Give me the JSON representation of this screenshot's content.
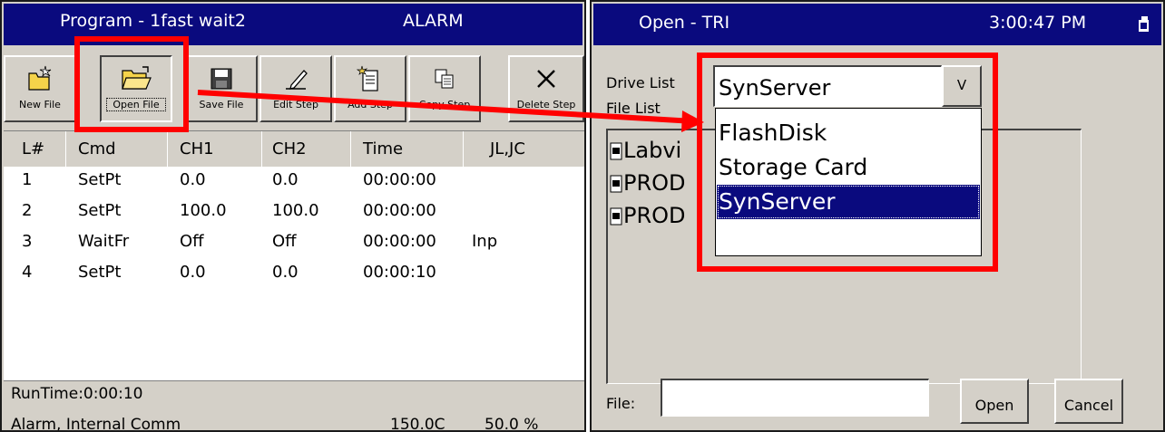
{
  "program": {
    "title": "Program - 1fast wait2",
    "alarm_label": "ALARM",
    "toolbar": [
      {
        "label": "New File",
        "icon": "new-file-icon"
      },
      {
        "label": "Open File",
        "icon": "open-folder-icon"
      },
      {
        "label": "Save File",
        "icon": "save-disk-icon"
      },
      {
        "label": "Edit Step",
        "icon": "pencil-icon"
      },
      {
        "label": "Add Step",
        "icon": "add-step-icon"
      },
      {
        "label": "Copy Step",
        "icon": "copy-icon"
      },
      {
        "label": "Delete Step",
        "icon": "delete-x-icon"
      }
    ],
    "columns": [
      "L#",
      "Cmd",
      "CH1",
      "CH2",
      "Time",
      "JL,JC"
    ],
    "rows": [
      [
        "1",
        "SetPt",
        "0.0",
        "0.0",
        "00:00:00",
        ""
      ],
      [
        "2",
        "SetPt",
        "100.0",
        "100.0",
        "00:00:00",
        ""
      ],
      [
        "3",
        "WaitFr",
        "Off",
        "Off",
        "00:00:00",
        "Inp"
      ],
      [
        "4",
        "SetPt",
        "0.0",
        "0.0",
        "00:00:10",
        ""
      ]
    ],
    "status": {
      "runtime": "RunTime:0:00:10",
      "alarm": "Alarm, Internal Comm",
      "temp": "150.0C",
      "percent": "50.0 %"
    }
  },
  "open_dialog": {
    "title": "Open - TRI",
    "time": "3:00:47 PM",
    "drive_list_label": "Drive List",
    "file_list_label": "File List",
    "drive_selected": "SynServer",
    "dropdown_button": "V",
    "drive_options": [
      "FlashDisk",
      "Storage Card",
      "SynServer"
    ],
    "files": [
      "Labvi",
      "PROD",
      "PROD"
    ],
    "file_label": "File:",
    "file_value": "",
    "open_button": "Open",
    "cancel_button": "Cancel"
  },
  "colors": {
    "titlebar": "#0a0a7e",
    "face": "#d4d0c8",
    "highlight": "#ff0000"
  }
}
